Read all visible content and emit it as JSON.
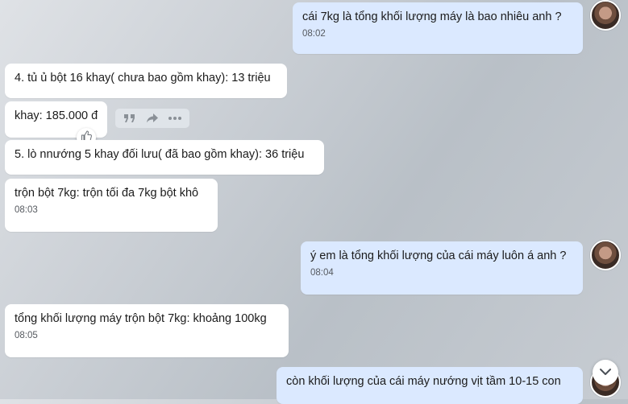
{
  "messages": [
    {
      "text": "cái 7kg là tổng khối lượng máy là bao  nhiêu anh ?",
      "time": "08:02"
    },
    {
      "text": "4. tủ ủ bột 16 khay( chưa bao gồm khay): 13 triệu"
    },
    {
      "text": "khay: 185.000 đ"
    },
    {
      "text": "5. lò nnướng 5 khay đối lưu( đã bao gồm khay): 36 triệu"
    },
    {
      "text": "trộn bột 7kg: trộn tối đa 7kg bột khô",
      "time": "08:03"
    },
    {
      "text": "ý em là tổng khối lượng của cái máy luôn á anh ?",
      "time": "08:04"
    },
    {
      "text": "tổng khối lượng máy trộn bột 7kg: khoảng 100kg",
      "time": "08:05"
    },
    {
      "text": "còn khối lượng của cái máy nướng vịt tầm 10-15 con"
    }
  ],
  "icons": {
    "quote": "quote-icon",
    "forward": "forward-icon",
    "more": "more-icon",
    "like": "thumbs-up-icon",
    "scroll": "chevron-down-icon"
  },
  "colors": {
    "incoming_bubble": "#ffffff",
    "outgoing_bubble": "#dbe9ff",
    "time_text": "#55595f"
  }
}
